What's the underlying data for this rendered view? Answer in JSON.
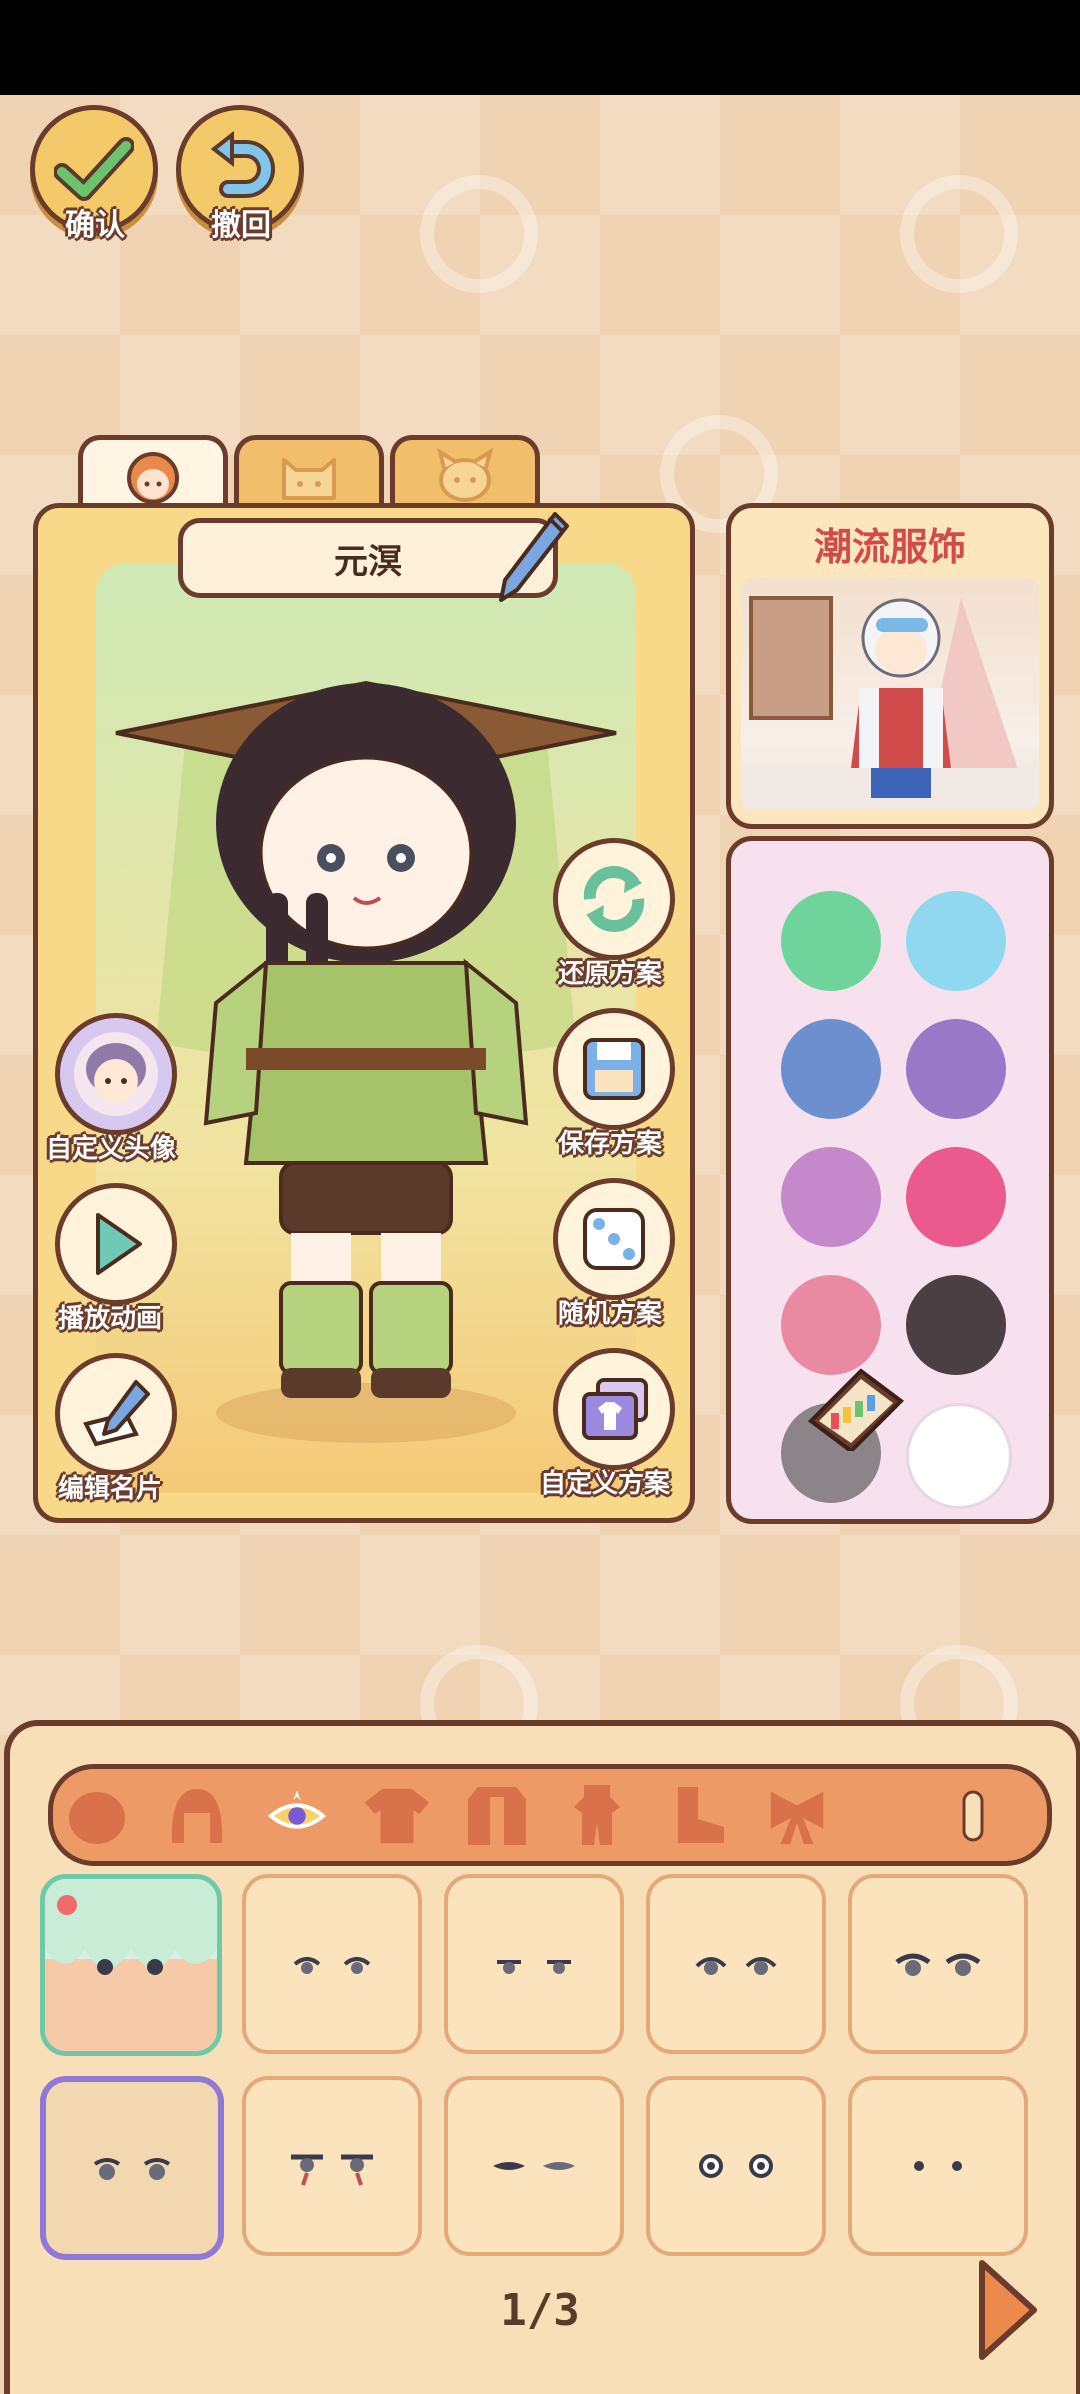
{
  "top_buttons": {
    "confirm_label": "确认",
    "undo_label": "撤回"
  },
  "tabs": [
    {
      "name": "character",
      "icon": "girl-face-icon",
      "active": true
    },
    {
      "name": "pet-cat",
      "icon": "cat-face-icon",
      "active": false
    },
    {
      "name": "pet-dog",
      "icon": "dog-face-icon",
      "active": false
    }
  ],
  "character": {
    "name": "元溟"
  },
  "side_actions": {
    "reset_label": "还原方案",
    "save_label": "保存方案",
    "random_label": "随机方案",
    "custom_plan_label": "自定义方案",
    "custom_avatar_label": "自定义头像",
    "play_anim_label": "播放动画",
    "edit_card_label": "编辑名片"
  },
  "promo": {
    "title": "潮流服饰"
  },
  "palette": {
    "colors": [
      "#6fd49b",
      "#8fd8ef",
      "#6d8fd0",
      "#9a78c8",
      "#c588cb",
      "#ea5a8c",
      "#ea8aa2",
      "#4b3f44",
      "#8c8489",
      "#ffffff"
    ]
  },
  "categories": [
    "face-icon",
    "hair-icon",
    "eyes-icon",
    "top-icon",
    "coat-icon",
    "outfit-icon",
    "shoes-icon",
    "bow-icon"
  ],
  "items": {
    "page": "1/3",
    "count": 10
  }
}
